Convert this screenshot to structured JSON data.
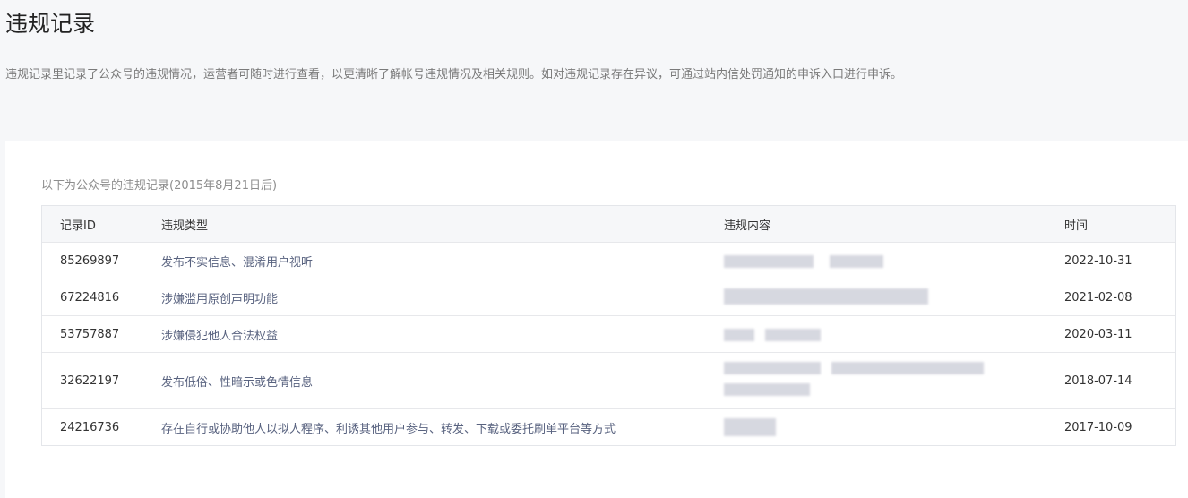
{
  "page": {
    "title": "违规记录",
    "description": "违规记录里记录了公众号的违规情况，运营者可随时进行查看，以更清晰了解帐号违规情况及相关规则。如对违规记录存在异议，可通过站内信处罚通知的申诉入口进行申诉。"
  },
  "table": {
    "caption": "以下为公众号的违规记录(2015年8月21日后)",
    "headers": {
      "id": "记录ID",
      "type": "违规类型",
      "content": "违规内容",
      "time": "时间"
    },
    "rows": [
      {
        "id": "85269897",
        "type": "发布不实信息、混淆用户视听",
        "time": "2022-10-31"
      },
      {
        "id": "67224816",
        "type": "涉嫌滥用原创声明功能",
        "time": "2021-02-08"
      },
      {
        "id": "53757887",
        "type": "涉嫌侵犯他人合法权益",
        "time": "2020-03-11"
      },
      {
        "id": "32622197",
        "type": "发布低俗、性暗示或色情信息",
        "time": "2018-07-14"
      },
      {
        "id": "24216736",
        "type": "存在自行或协助他人以拟人程序、利诱其他用户参与、转发、下载或委托刷单平台等方式",
        "time": "2017-10-09"
      }
    ]
  },
  "colors": {
    "background": "#f6f7f9",
    "card": "#ffffff",
    "link_text": "#58627f",
    "caption_text": "#8d8d8d",
    "border": "#e4e6ea"
  }
}
